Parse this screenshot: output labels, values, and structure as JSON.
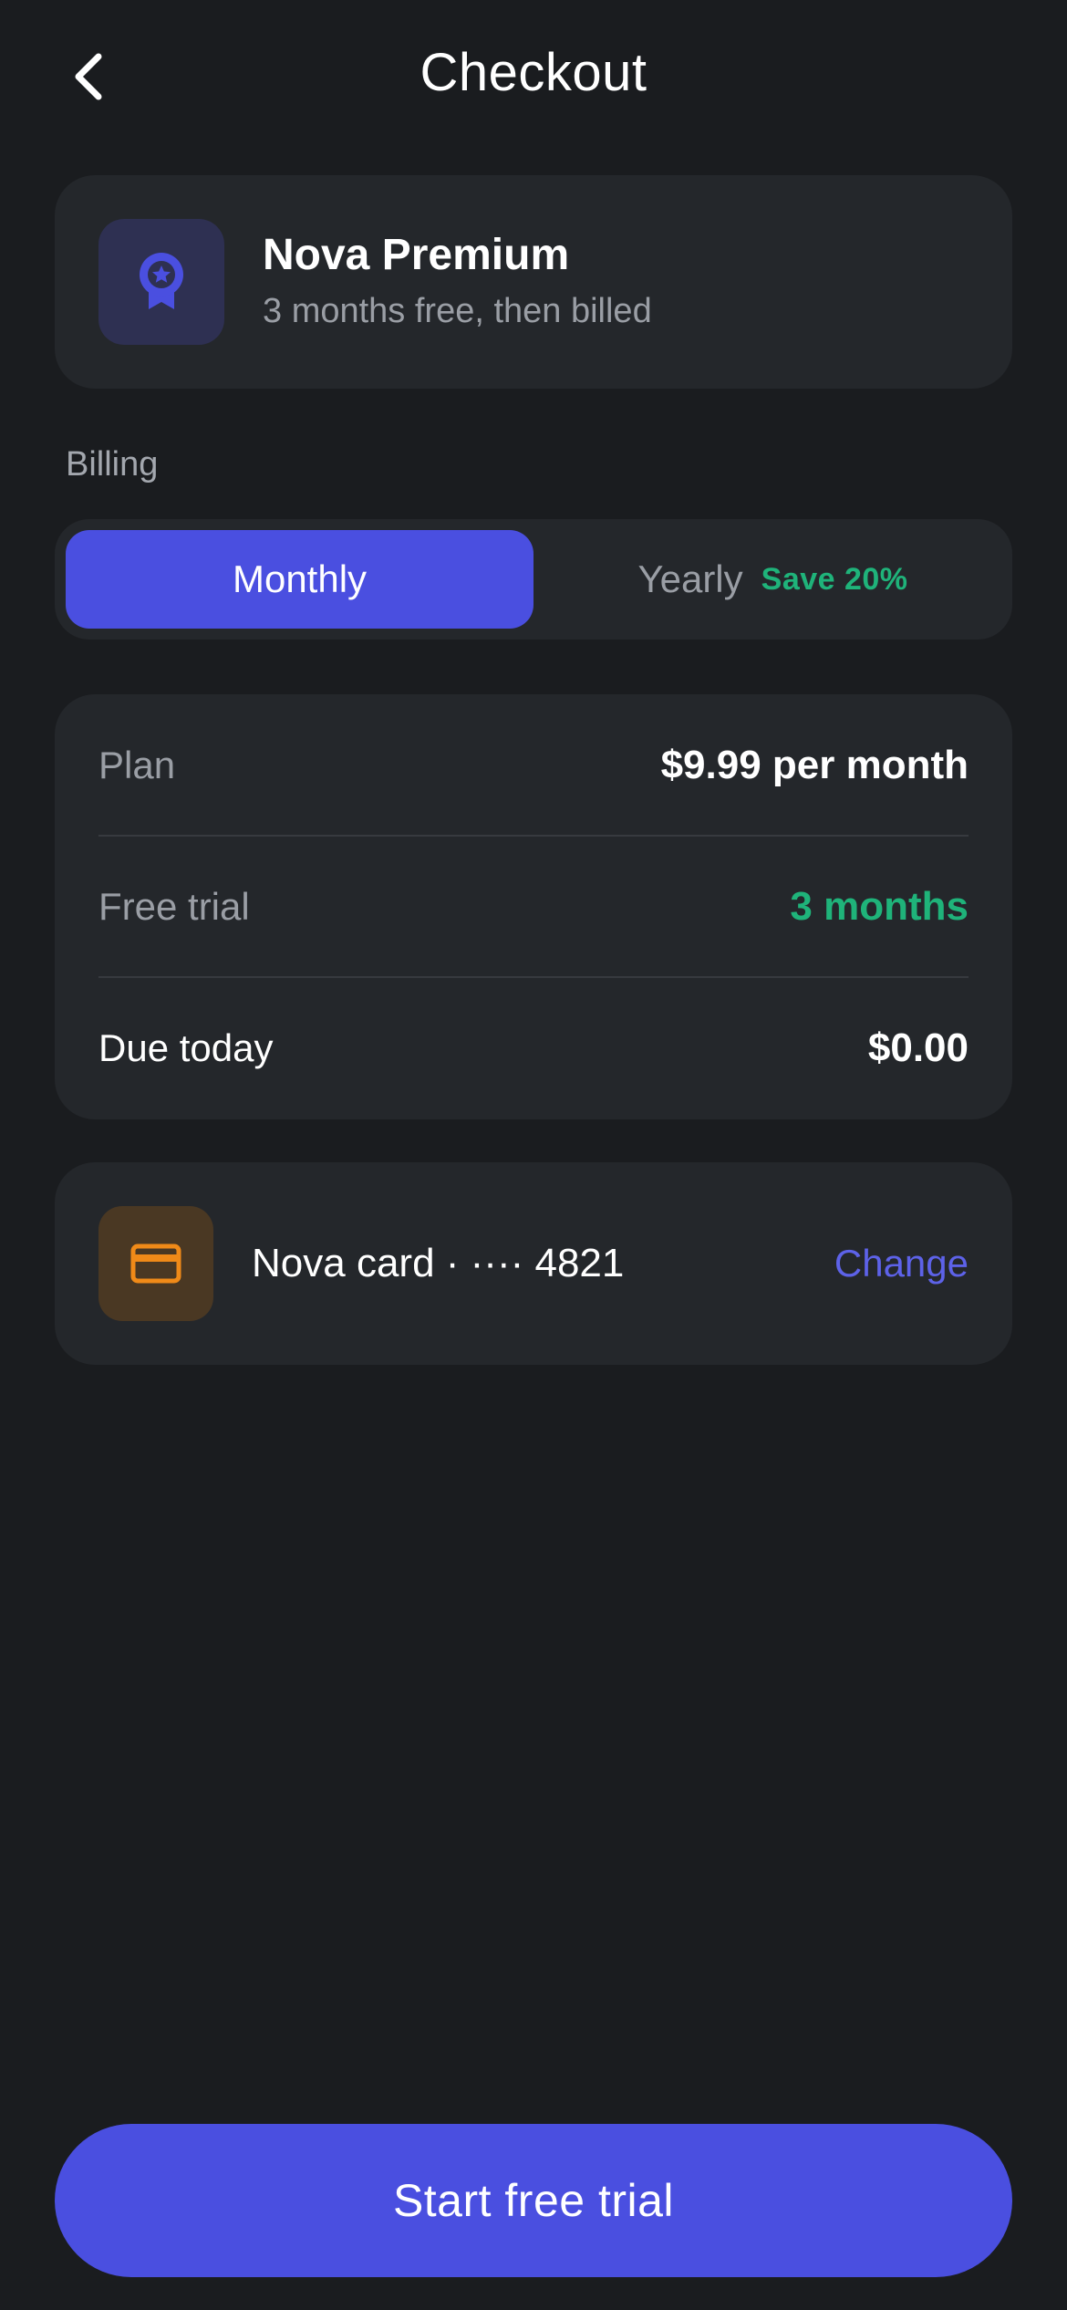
{
  "header": {
    "title": "Checkout",
    "back_icon": "chevron-left-icon"
  },
  "product": {
    "name": "Nova Premium",
    "subtitle": "3 months free, then billed",
    "icon": "award-badge-icon",
    "icon_color": "#4a4fe0"
  },
  "billing": {
    "label": "Billing",
    "selected": "Monthly",
    "options": [
      {
        "label": "Monthly",
        "selected": true
      },
      {
        "label": "Yearly",
        "selected": false,
        "badge": "Save 20%"
      }
    ]
  },
  "summary": {
    "rows": [
      {
        "label": "Plan",
        "value": "$9.99 per month"
      },
      {
        "label": "Free trial",
        "value": "3 months"
      },
      {
        "label": "Due today",
        "value": "$0.00"
      }
    ]
  },
  "payment": {
    "icon": "credit-card-icon",
    "icon_color": "#f08a18",
    "text": "Nova card · ···· 4821",
    "change_label": "Change"
  },
  "cta": {
    "label": "Start free trial"
  },
  "colors": {
    "background": "#1a1c1f",
    "card": "#24272b",
    "accent": "#4a4fe0",
    "success": "#1fb37a",
    "link": "#5d62e8"
  }
}
